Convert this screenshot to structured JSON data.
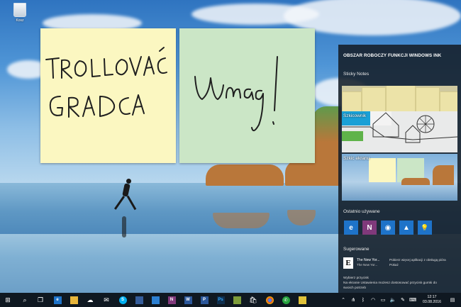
{
  "desktop": {
    "recycle_bin_label": "Kosz"
  },
  "notes": [
    {
      "color": "#fbf7c1",
      "lines": [
        "TROLLOVAC",
        "GRADCA"
      ]
    },
    {
      "color": "#cbe6c6",
      "lines": [
        "Uwaga!"
      ]
    }
  ],
  "ink_workspace": {
    "title": "OBSZAR ROBOCZY FUNKCJI WINDOWS INK",
    "sticky_notes_label": "Sticky Notes",
    "sketchpad_label": "Szkicownik",
    "screen_sketch_label": "Szkic ekranu",
    "recent_label": "Ostatnio używane",
    "recent_apps": [
      {
        "name": "Microsoft Edge",
        "icon": "edge-icon",
        "color": "#1e73c9",
        "glyph": "e"
      },
      {
        "name": "OneNote",
        "icon": "onenote-icon",
        "color": "#80397b",
        "glyph": "N"
      },
      {
        "name": "Mapy",
        "icon": "maps-icon",
        "color": "#1e73c9",
        "glyph": "◉"
      },
      {
        "name": "Zdjęcia",
        "icon": "photos-icon",
        "color": "#1e73c9",
        "glyph": "▲"
      },
      {
        "name": "Porady",
        "icon": "tips-icon",
        "color": "#1e73c9",
        "glyph": "💡"
      }
    ],
    "suggested_label": "Sugerowane",
    "suggestion": {
      "icon_glyph": "E",
      "name": "The New Yor...",
      "sub": "The New Yor...",
      "description": "Pobierz więcej aplikacji z obsługą pióra",
      "link": "Pokaż"
    },
    "footer_lines": [
      "Wybierz przycisk",
      "Na ekranie Ustawienia możesz dostosować przycisk gumki do",
      "swoich potrzeb"
    ]
  },
  "taskbar": {
    "items": [
      {
        "name": "start-button",
        "glyph": "⊞",
        "color": ""
      },
      {
        "name": "search-button",
        "glyph": "⌕",
        "color": ""
      },
      {
        "name": "task-view-button",
        "glyph": "❐",
        "color": ""
      },
      {
        "name": "edge-taskbar",
        "glyph": "e",
        "color": "#1e73c9"
      },
      {
        "name": "explorer-taskbar",
        "glyph": "▬",
        "color": "#e7b53b"
      },
      {
        "name": "onedrive-taskbar",
        "glyph": "☁",
        "color": ""
      },
      {
        "name": "mail-taskbar",
        "glyph": "✉",
        "color": ""
      },
      {
        "name": "store-taskbar",
        "glyph": "⧉",
        "color": ""
      },
      {
        "name": "skype-taskbar",
        "glyph": "S",
        "color": "#00aff0"
      },
      {
        "name": "app-taskbar",
        "glyph": "◫",
        "color": "#355d9b"
      },
      {
        "name": "messaging-taskbar",
        "glyph": "▬",
        "color": "#2c7fd1"
      },
      {
        "name": "onenote-taskbar",
        "glyph": "N",
        "color": "#80397b"
      },
      {
        "name": "word-taskbar",
        "glyph": "W",
        "color": "#2b579a"
      },
      {
        "name": "powerpoint-taskbar",
        "glyph": "P",
        "color": "#2b579a"
      },
      {
        "name": "photoshop-taskbar",
        "glyph": "Ps",
        "color": "#0f2e4d"
      },
      {
        "name": "gallery-taskbar",
        "glyph": "▦",
        "color": "#7d9c3a"
      },
      {
        "name": "store2-taskbar",
        "glyph": "🛍",
        "color": ""
      },
      {
        "name": "whatsapp-taskbar",
        "glyph": "✆",
        "color": "#27a33f"
      },
      {
        "name": "notes-taskbar",
        "glyph": "▤",
        "color": "#e0c23a"
      }
    ],
    "time": "12:17",
    "date": "03.08.2016"
  }
}
